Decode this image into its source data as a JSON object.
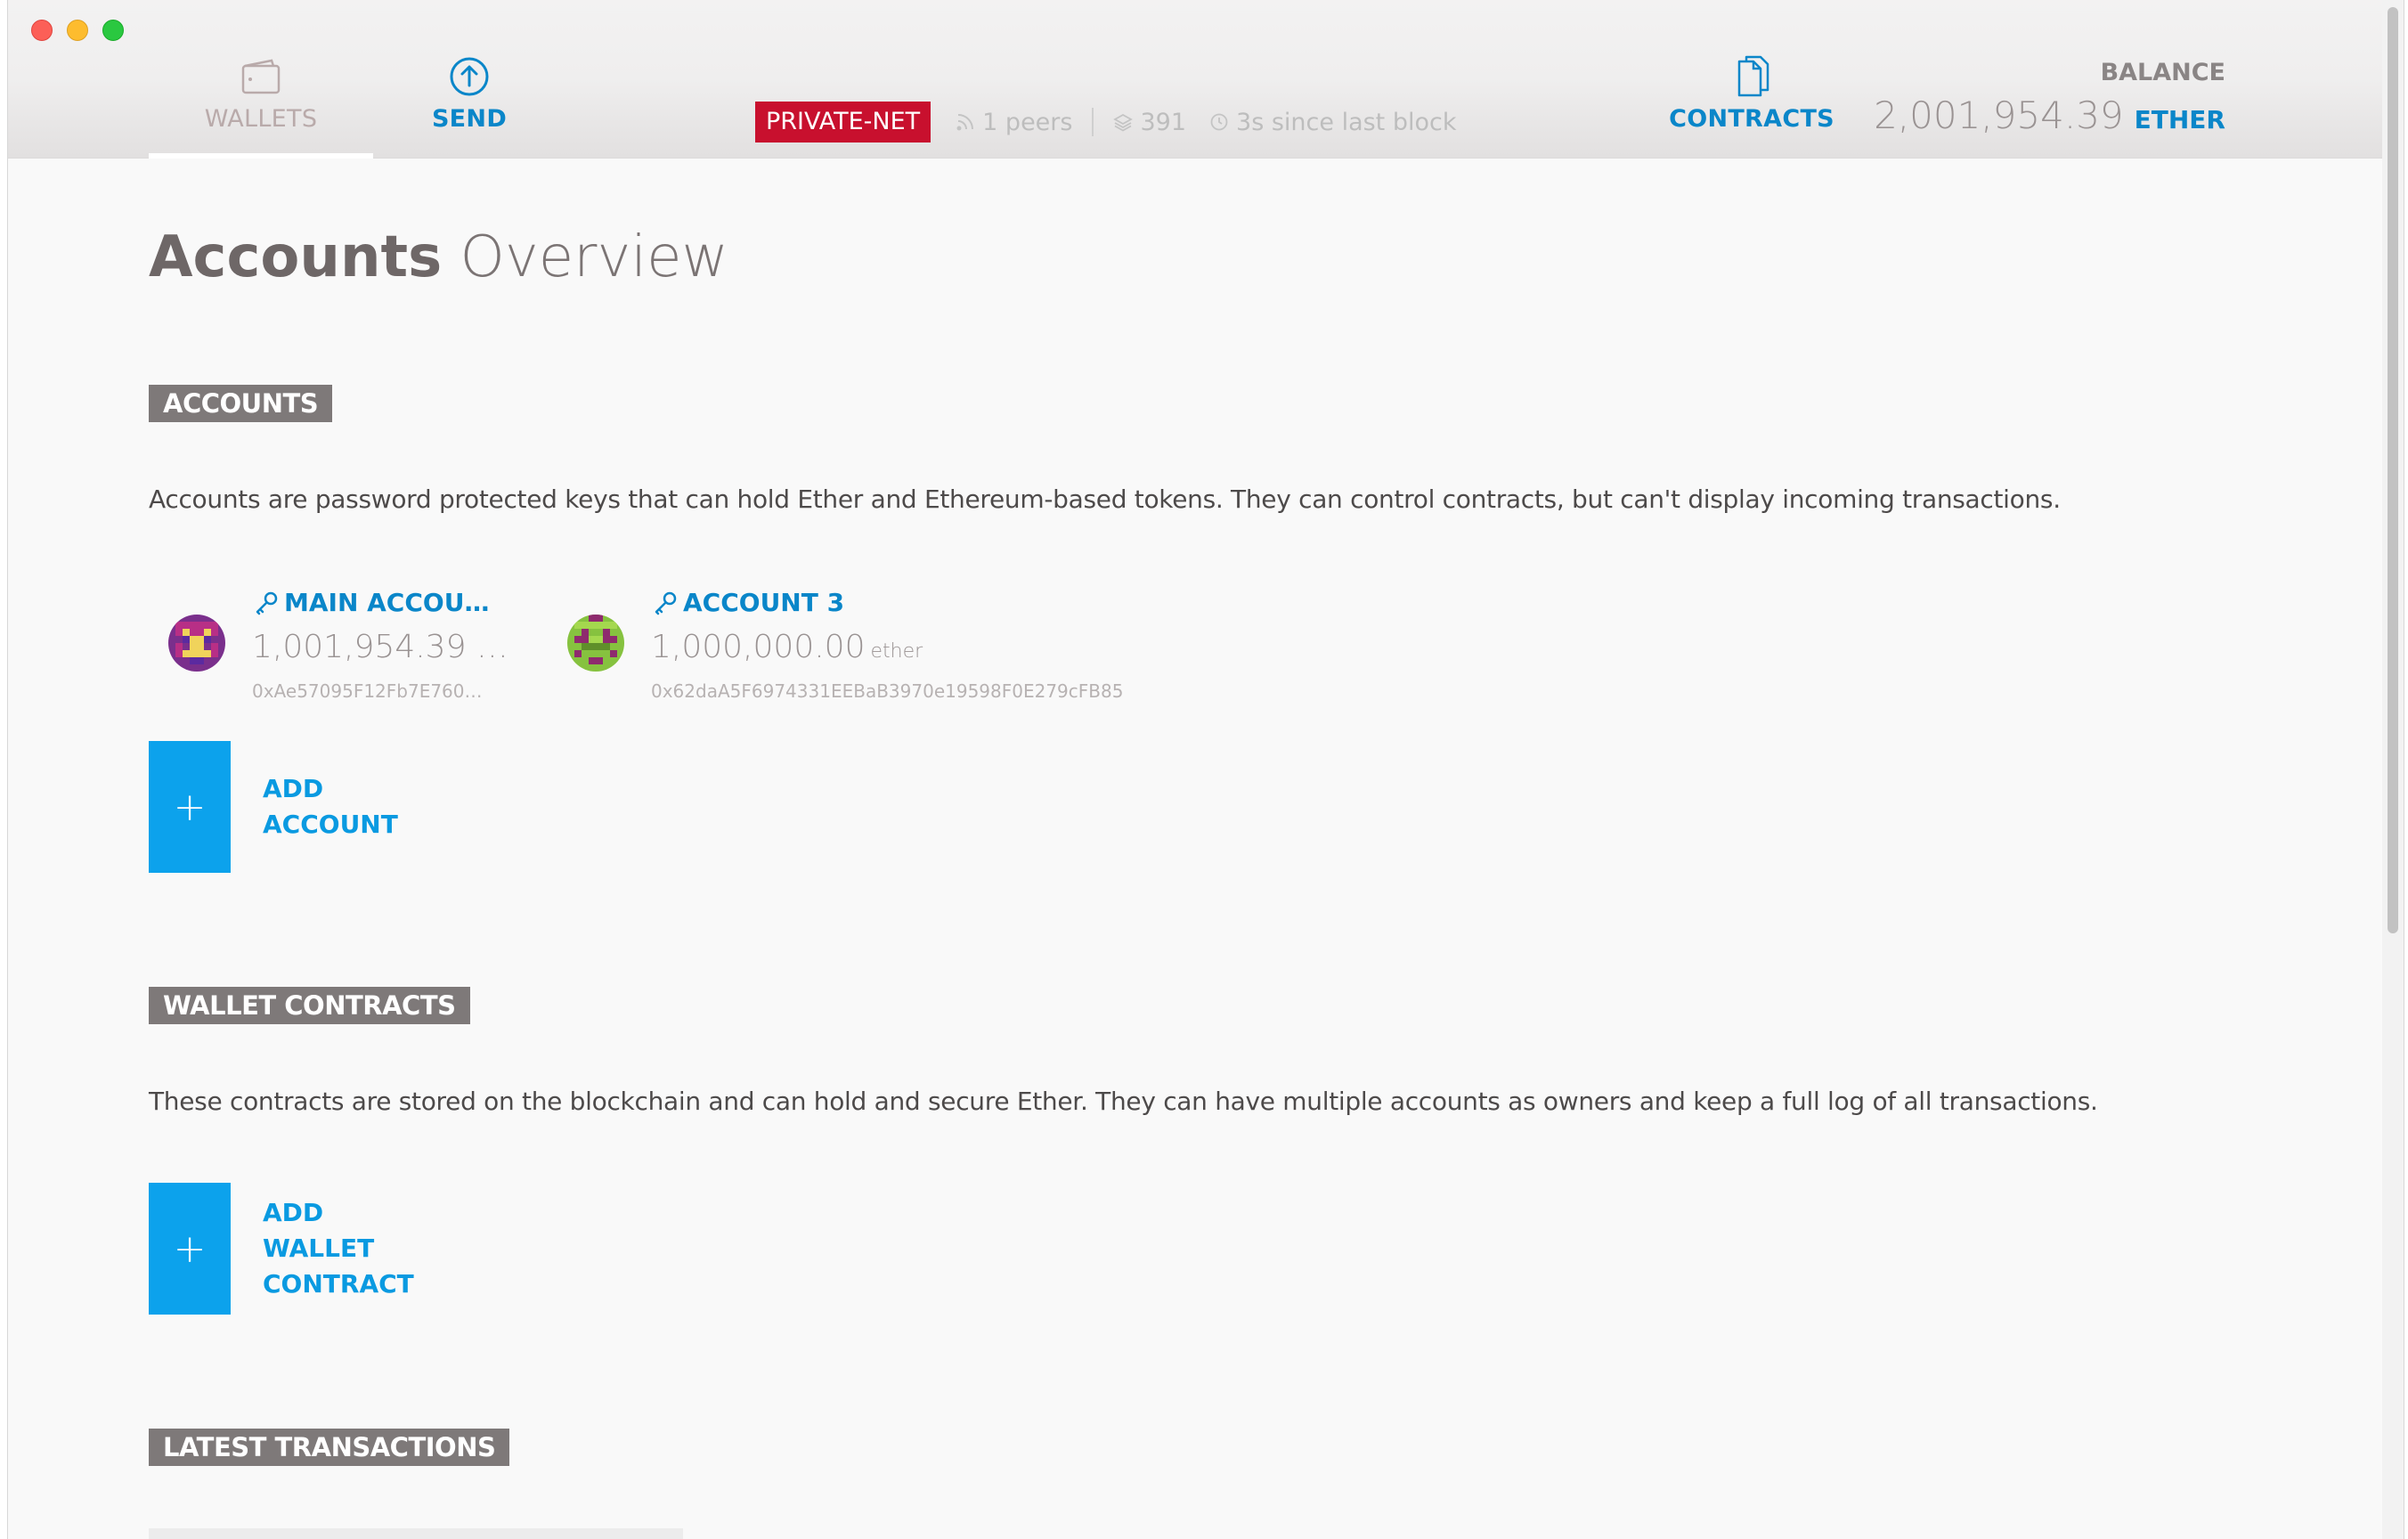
{
  "window": {
    "controls": [
      "close",
      "minimize",
      "maximize"
    ]
  },
  "nav": {
    "wallets": {
      "label": "WALLETS",
      "icon": "wallet-icon"
    },
    "send": {
      "label": "SEND",
      "icon": "arrow-up-circle-icon"
    },
    "contracts": {
      "label": "CONTRACTS",
      "icon": "documents-icon"
    }
  },
  "network": {
    "badge": "PRIVATE-NET",
    "peers": "1 peers",
    "block": "391",
    "since_last_block": "3s since last block"
  },
  "balance": {
    "label": "BALANCE",
    "value": "2,001,954.39",
    "unit": "ETHER"
  },
  "page": {
    "title_strong": "Accounts",
    "title_light": "Overview"
  },
  "accounts_section": {
    "label": "ACCOUNTS",
    "description": "Accounts are password protected keys that can hold Ether and Ethereum-based tokens. They can control contracts, but can't display incoming transactions.",
    "accounts": [
      {
        "name": "MAIN ACCOU…",
        "balance": "1,001,954.39 …",
        "unit": "",
        "address": "0xAe57095F12Fb7E760…",
        "identicon_colors": [
          "#7a2f8c",
          "#b82f86",
          "#f0d35b",
          "#5b2aa0"
        ]
      },
      {
        "name": "ACCOUNT 3",
        "balance": "1,000,000.00",
        "unit": "ether",
        "address": "0x62daA5F6974331EEBaB3970e19598F0E279cFB85",
        "identicon_colors": [
          "#86c23f",
          "#8e2a6e",
          "#a4d84e",
          "#5f8f2a"
        ]
      }
    ],
    "add_label": "ADD ACCOUNT"
  },
  "wallet_contracts_section": {
    "label": "WALLET CONTRACTS",
    "description": "These contracts are stored on the blockchain and can hold and secure Ether. They can have multiple accounts as owners and keep a full log of all transactions.",
    "add_label": "ADD WALLET CONTRACT"
  },
  "latest_transactions_section": {
    "label": "LATEST TRANSACTIONS"
  },
  "colors": {
    "accent": "#0a86c9",
    "add_button": "#0ca2ec",
    "net_badge": "#c8102e",
    "section_label_bg": "#7e7979"
  }
}
